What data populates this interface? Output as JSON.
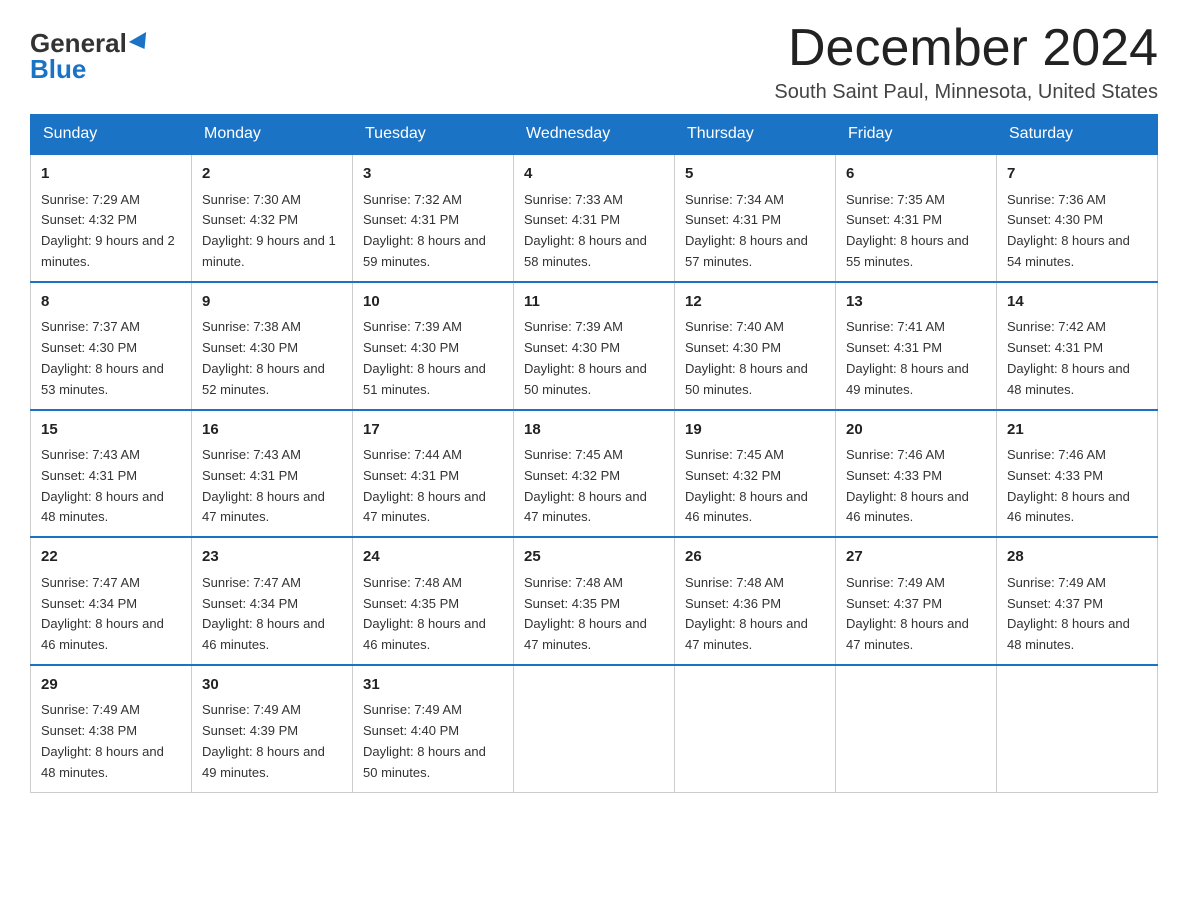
{
  "logo": {
    "general": "General",
    "blue": "Blue"
  },
  "title": {
    "month_year": "December 2024",
    "location": "South Saint Paul, Minnesota, United States"
  },
  "headers": [
    "Sunday",
    "Monday",
    "Tuesday",
    "Wednesday",
    "Thursday",
    "Friday",
    "Saturday"
  ],
  "weeks": [
    [
      {
        "day": "1",
        "sunrise": "7:29 AM",
        "sunset": "4:32 PM",
        "daylight": "9 hours and 2 minutes."
      },
      {
        "day": "2",
        "sunrise": "7:30 AM",
        "sunset": "4:32 PM",
        "daylight": "9 hours and 1 minute."
      },
      {
        "day": "3",
        "sunrise": "7:32 AM",
        "sunset": "4:31 PM",
        "daylight": "8 hours and 59 minutes."
      },
      {
        "day": "4",
        "sunrise": "7:33 AM",
        "sunset": "4:31 PM",
        "daylight": "8 hours and 58 minutes."
      },
      {
        "day": "5",
        "sunrise": "7:34 AM",
        "sunset": "4:31 PM",
        "daylight": "8 hours and 57 minutes."
      },
      {
        "day": "6",
        "sunrise": "7:35 AM",
        "sunset": "4:31 PM",
        "daylight": "8 hours and 55 minutes."
      },
      {
        "day": "7",
        "sunrise": "7:36 AM",
        "sunset": "4:30 PM",
        "daylight": "8 hours and 54 minutes."
      }
    ],
    [
      {
        "day": "8",
        "sunrise": "7:37 AM",
        "sunset": "4:30 PM",
        "daylight": "8 hours and 53 minutes."
      },
      {
        "day": "9",
        "sunrise": "7:38 AM",
        "sunset": "4:30 PM",
        "daylight": "8 hours and 52 minutes."
      },
      {
        "day": "10",
        "sunrise": "7:39 AM",
        "sunset": "4:30 PM",
        "daylight": "8 hours and 51 minutes."
      },
      {
        "day": "11",
        "sunrise": "7:39 AM",
        "sunset": "4:30 PM",
        "daylight": "8 hours and 50 minutes."
      },
      {
        "day": "12",
        "sunrise": "7:40 AM",
        "sunset": "4:30 PM",
        "daylight": "8 hours and 50 minutes."
      },
      {
        "day": "13",
        "sunrise": "7:41 AM",
        "sunset": "4:31 PM",
        "daylight": "8 hours and 49 minutes."
      },
      {
        "day": "14",
        "sunrise": "7:42 AM",
        "sunset": "4:31 PM",
        "daylight": "8 hours and 48 minutes."
      }
    ],
    [
      {
        "day": "15",
        "sunrise": "7:43 AM",
        "sunset": "4:31 PM",
        "daylight": "8 hours and 48 minutes."
      },
      {
        "day": "16",
        "sunrise": "7:43 AM",
        "sunset": "4:31 PM",
        "daylight": "8 hours and 47 minutes."
      },
      {
        "day": "17",
        "sunrise": "7:44 AM",
        "sunset": "4:31 PM",
        "daylight": "8 hours and 47 minutes."
      },
      {
        "day": "18",
        "sunrise": "7:45 AM",
        "sunset": "4:32 PM",
        "daylight": "8 hours and 47 minutes."
      },
      {
        "day": "19",
        "sunrise": "7:45 AM",
        "sunset": "4:32 PM",
        "daylight": "8 hours and 46 minutes."
      },
      {
        "day": "20",
        "sunrise": "7:46 AM",
        "sunset": "4:33 PM",
        "daylight": "8 hours and 46 minutes."
      },
      {
        "day": "21",
        "sunrise": "7:46 AM",
        "sunset": "4:33 PM",
        "daylight": "8 hours and 46 minutes."
      }
    ],
    [
      {
        "day": "22",
        "sunrise": "7:47 AM",
        "sunset": "4:34 PM",
        "daylight": "8 hours and 46 minutes."
      },
      {
        "day": "23",
        "sunrise": "7:47 AM",
        "sunset": "4:34 PM",
        "daylight": "8 hours and 46 minutes."
      },
      {
        "day": "24",
        "sunrise": "7:48 AM",
        "sunset": "4:35 PM",
        "daylight": "8 hours and 46 minutes."
      },
      {
        "day": "25",
        "sunrise": "7:48 AM",
        "sunset": "4:35 PM",
        "daylight": "8 hours and 47 minutes."
      },
      {
        "day": "26",
        "sunrise": "7:48 AM",
        "sunset": "4:36 PM",
        "daylight": "8 hours and 47 minutes."
      },
      {
        "day": "27",
        "sunrise": "7:49 AM",
        "sunset": "4:37 PM",
        "daylight": "8 hours and 47 minutes."
      },
      {
        "day": "28",
        "sunrise": "7:49 AM",
        "sunset": "4:37 PM",
        "daylight": "8 hours and 48 minutes."
      }
    ],
    [
      {
        "day": "29",
        "sunrise": "7:49 AM",
        "sunset": "4:38 PM",
        "daylight": "8 hours and 48 minutes."
      },
      {
        "day": "30",
        "sunrise": "7:49 AM",
        "sunset": "4:39 PM",
        "daylight": "8 hours and 49 minutes."
      },
      {
        "day": "31",
        "sunrise": "7:49 AM",
        "sunset": "4:40 PM",
        "daylight": "8 hours and 50 minutes."
      },
      null,
      null,
      null,
      null
    ]
  ]
}
